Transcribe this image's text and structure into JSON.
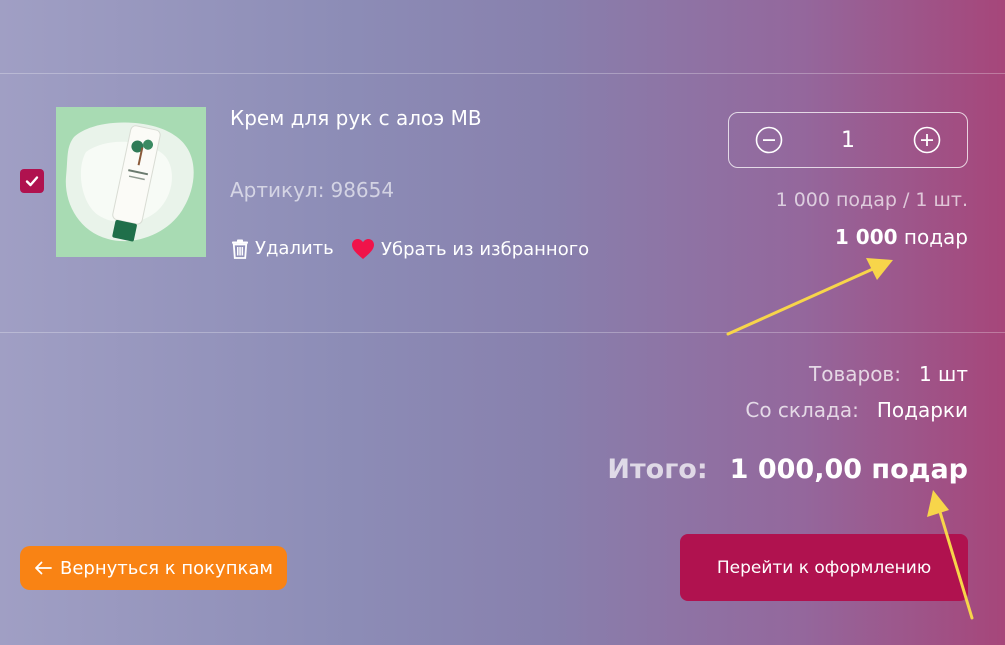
{
  "product": {
    "title": "Крем для рук с алоэ MB",
    "sku_label": "Артикул:",
    "sku_value": "98654",
    "checked": true,
    "delete_label": "Удалить",
    "favorite_label": "Убрать из избранного",
    "quantity": "1",
    "unit_price": "1 000 подар / 1 шт.",
    "total_amount": "1 000",
    "total_currency": "подар"
  },
  "summary": {
    "items_label": "Товаров:",
    "items_value": "1 шт",
    "warehouse_label": "Со склада:",
    "warehouse_value": "Подарки",
    "total_label": "Итого:",
    "total_value": "1 000,00 подар"
  },
  "actions": {
    "back_label": "Вернуться к покупкам",
    "checkout_label": "Перейти к оформлению"
  },
  "colors": {
    "accent": "#b0124f",
    "back_button": "#f98314",
    "annotation_arrow": "#f7d54a",
    "heart": "#f0134a"
  },
  "icons": [
    "checkmark-icon",
    "trash-icon",
    "heart-icon",
    "minus-icon",
    "plus-icon",
    "arrow-left-icon"
  ]
}
